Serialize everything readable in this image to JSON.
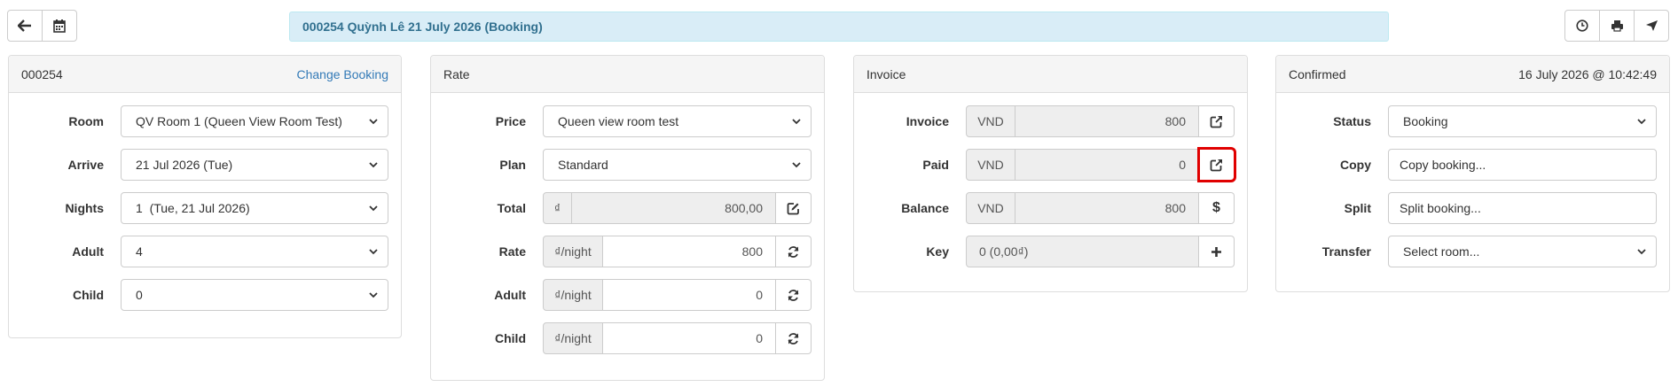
{
  "toolbar": {
    "left": [
      {
        "icon": "arrow-left-icon"
      },
      {
        "icon": "calendar-icon"
      }
    ],
    "right": [
      {
        "icon": "clock-icon"
      },
      {
        "icon": "print-icon"
      },
      {
        "icon": "send-icon"
      }
    ]
  },
  "banner": {
    "text": "000254  Quỳnh Lê  21 July 2026  (Booking)"
  },
  "booking": {
    "title": "000254",
    "link": "Change Booking",
    "room": {
      "label": "Room",
      "value": "QV Room 1 (Queen View Room Test)"
    },
    "arrive": {
      "label": "Arrive",
      "value": "21 Jul 2026 (Tue)"
    },
    "nights": {
      "label": "Nights",
      "value": "1  (Tue, 21 Jul 2026)"
    },
    "adult": {
      "label": "Adult",
      "value": "4"
    },
    "child": {
      "label": "Child",
      "value": "0"
    }
  },
  "rate": {
    "title": "Rate",
    "price": {
      "label": "Price",
      "value": "Queen view room test"
    },
    "plan": {
      "label": "Plan",
      "value": "Standard"
    },
    "total": {
      "label": "Total",
      "addon": "₫",
      "value": "800,00"
    },
    "rate": {
      "label": "Rate",
      "addon": "₫/night",
      "value": "800"
    },
    "adult": {
      "label": "Adult",
      "addon": "₫/night",
      "value": "0"
    },
    "child": {
      "label": "Child",
      "addon": "₫/night",
      "value": "0"
    }
  },
  "invoice": {
    "title": "Invoice",
    "invoice": {
      "label": "Invoice",
      "currency": "VND",
      "value": "800"
    },
    "paid": {
      "label": "Paid",
      "currency": "VND",
      "value": "0"
    },
    "balance": {
      "label": "Balance",
      "currency": "VND",
      "value": "800",
      "icon_text": "$"
    },
    "key": {
      "label": "Key",
      "value": "0 (0,00₫)"
    }
  },
  "status": {
    "title": "Confirmed",
    "timestamp": "16 July 2026 @ 10:42:49",
    "status": {
      "label": "Status",
      "value": "Booking"
    },
    "copy": {
      "label": "Copy",
      "value": "Copy booking..."
    },
    "split": {
      "label": "Split",
      "value": "Split booking..."
    },
    "transfer": {
      "label": "Transfer",
      "value": "Select room..."
    }
  }
}
